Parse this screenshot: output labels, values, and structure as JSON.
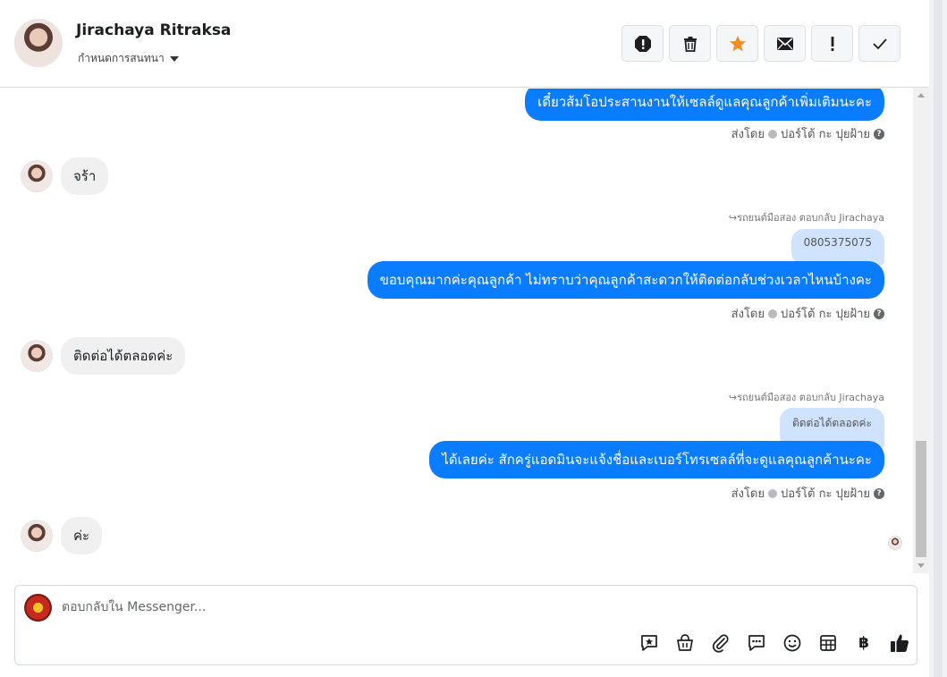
{
  "header": {
    "contact_name": "Jirachaya Ritraksa",
    "assign_label": "กำหนดการสนทนา",
    "actions": [
      "spam-icon",
      "trash-icon",
      "star-icon",
      "envelope-icon",
      "exclamation-icon",
      "check-icon"
    ],
    "star_color": "#f28c28"
  },
  "messages": {
    "m1": {
      "text": "เดี๋ยวส้มโอประสานงานให้เซลล์ดูแลคุณลูกค้าเพิ่มเติมนะคะ",
      "sent_by": "ส่งโดย",
      "agent": "ปอร์โต้ กะ ปุยฝ้าย"
    },
    "m2": {
      "text": "จร้า"
    },
    "m3": {
      "reply_to": "↪รถยนต์มือสอง ตอบกลับ Jirachaya",
      "quote": "0805375075",
      "text": "ขอบคุณมากค่ะคุณลูกค้า ไม่ทราบว่าคุณลูกค้าสะดวกให้ติดต่อกลับช่วงเวลาไหนบ้างคะ",
      "sent_by": "ส่งโดย",
      "agent": "ปอร์โต้ กะ ปุยฝ้าย"
    },
    "m4": {
      "text": "ติดต่อได้ตลอดค่ะ"
    },
    "m5": {
      "reply_to": "↪รถยนต์มือสอง ตอบกลับ Jirachaya",
      "quote": "ติดต่อได้ตลอดค่ะ",
      "text": "ได้เลยค่ะ สักครู่แอดมินจะแจ้งชื่อและเบอร์โทรเซลล์ที่จะดูแลคุณลูกค้านะคะ",
      "sent_by": "ส่งโดย",
      "agent": "ปอร์โต้ กะ ปุยฝ้าย"
    },
    "m6": {
      "text": "ค่ะ"
    }
  },
  "composer": {
    "placeholder": "ตอบกลับใน Messenger...",
    "currency_symbol": "฿",
    "tools": [
      "saved-reply-icon",
      "shop-bag-icon",
      "attachment-icon",
      "chat-bubble-icon",
      "emoji-icon",
      "table-icon",
      "baht-icon",
      "like-icon"
    ]
  },
  "colors": {
    "accent": "#0a7cff",
    "incoming_bubble": "#f0f0f0",
    "quote_bubble": "#cfe3ff"
  }
}
